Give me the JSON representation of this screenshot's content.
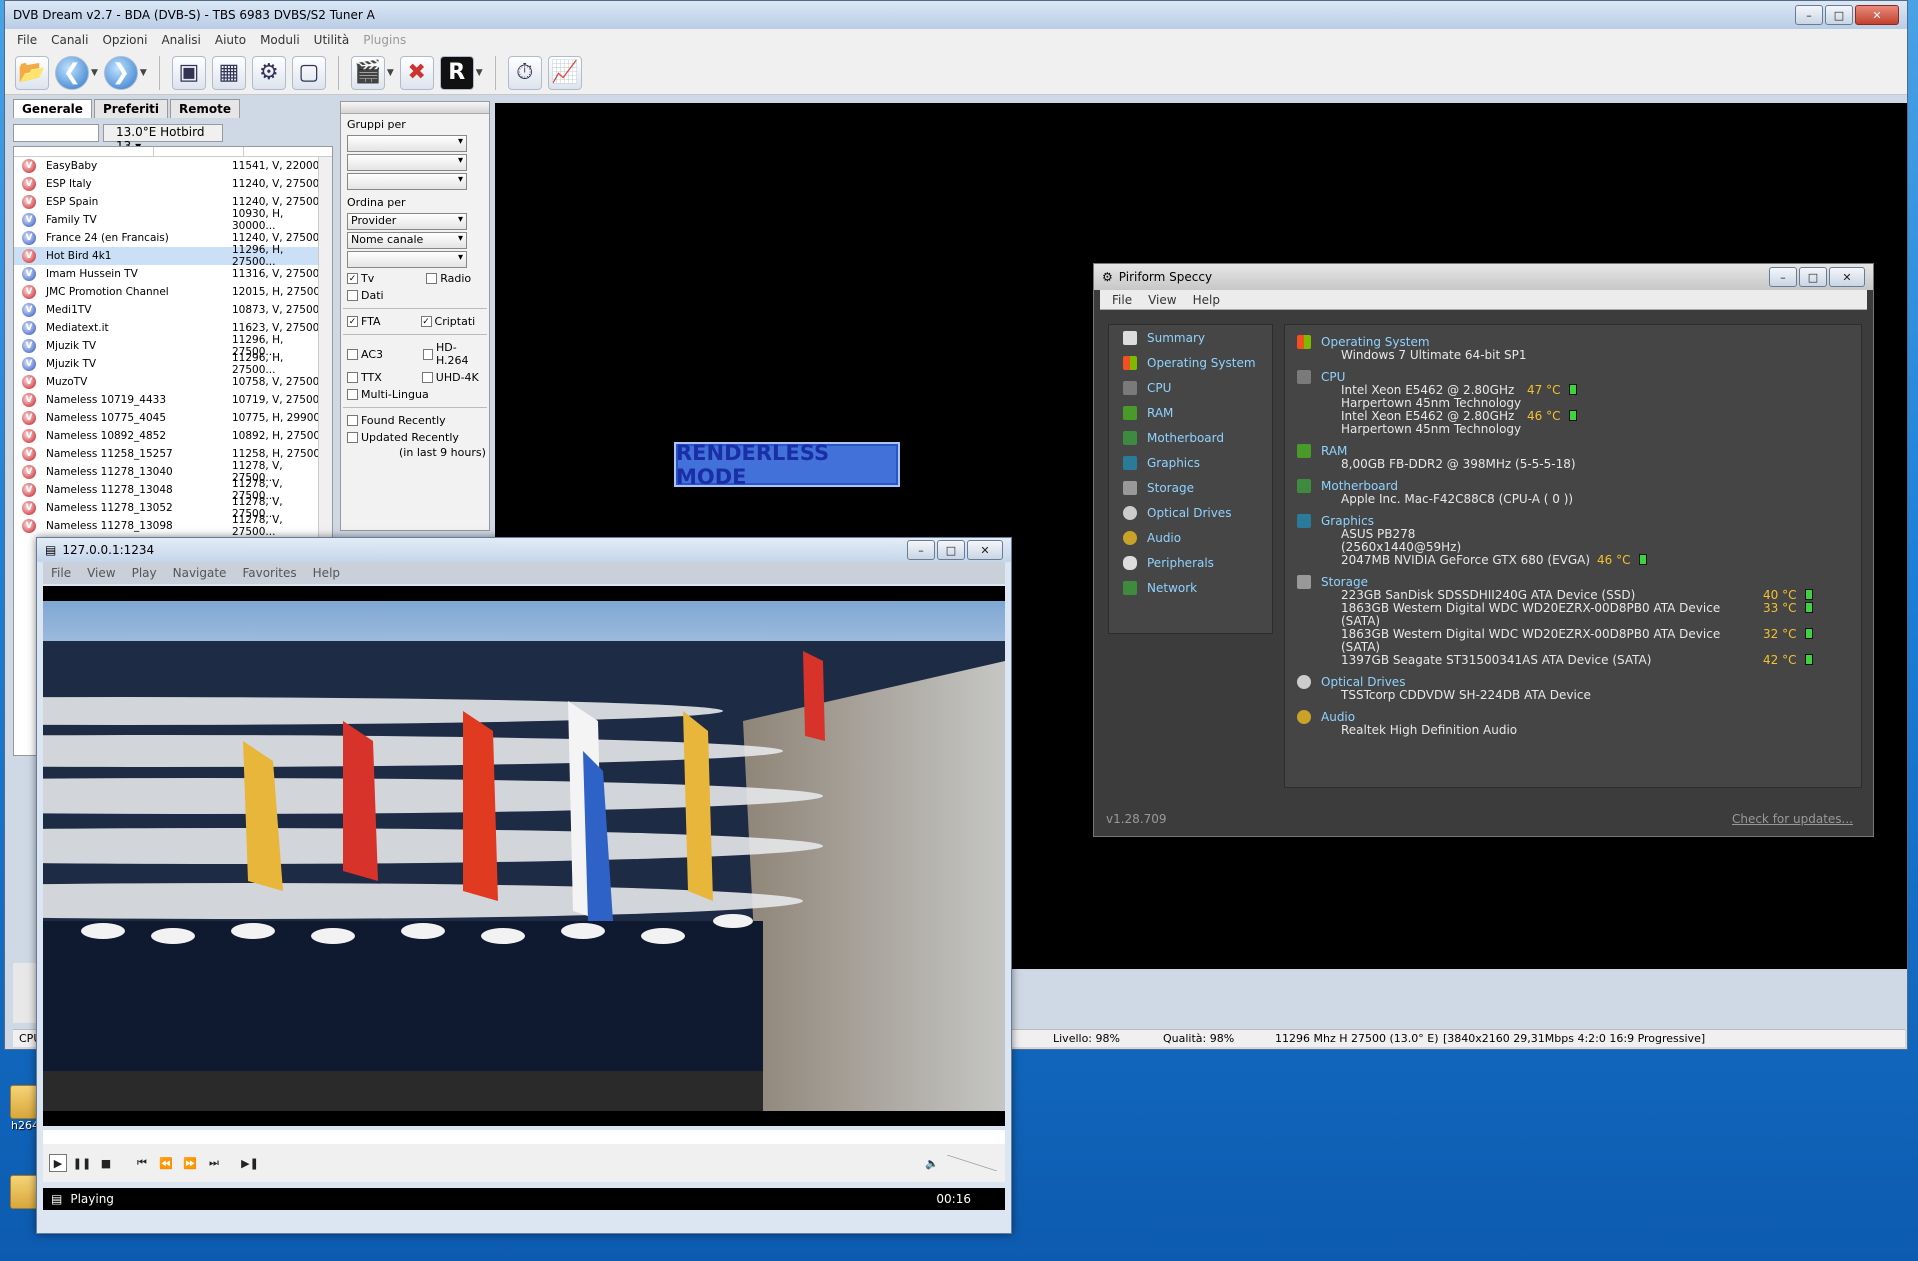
{
  "desktop": {
    "icons": [
      {
        "label": "h264ts"
      },
      {
        "label": ""
      }
    ]
  },
  "dvb": {
    "title": "DVB Dream v2.7 - BDA (DVB-S) - TBS 6983 DVBS/S2 Tuner A",
    "menu": [
      "File",
      "Canali",
      "Opzioni",
      "Analisi",
      "Aiuto",
      "Moduli",
      "Utilità",
      "Plugins"
    ],
    "tabs": [
      "Generale",
      "Preferiti",
      "Remote"
    ],
    "satellite": "13.0°E Hotbird 13",
    "channels": [
      {
        "name": "EasyBaby",
        "freq": "11541, V, 22000",
        "icon": "red"
      },
      {
        "name": "ESP Italy",
        "freq": "11240, V, 27500",
        "icon": "red"
      },
      {
        "name": "ESP Spain",
        "freq": "11240, V, 27500",
        "icon": "red"
      },
      {
        "name": "Family TV",
        "freq": "10930, H, 30000...",
        "icon": "blue"
      },
      {
        "name": "France 24 (en Francais)",
        "freq": "11240, V, 27500",
        "icon": "blue"
      },
      {
        "name": "Hot Bird 4k1",
        "freq": "11296, H, 27500...",
        "icon": "red"
      },
      {
        "name": "Imam Hussein TV",
        "freq": "11316, V, 27500",
        "icon": "blue"
      },
      {
        "name": "JMC Promotion Channel",
        "freq": "12015, H, 27500",
        "icon": "red"
      },
      {
        "name": "Medi1TV",
        "freq": "10873, V, 27500",
        "icon": "blue"
      },
      {
        "name": "Mediatext.it",
        "freq": "11623, V, 27500",
        "icon": "blue"
      },
      {
        "name": "Mjuzik TV",
        "freq": "11296, H, 27500...",
        "icon": "blue"
      },
      {
        "name": "Mjuzik TV",
        "freq": "11296, H, 27500...",
        "icon": "blue"
      },
      {
        "name": "MuzoTV",
        "freq": "10758, V, 27500",
        "icon": "red"
      },
      {
        "name": "Nameless 10719_4433",
        "freq": "10719, V, 27500",
        "icon": "red"
      },
      {
        "name": "Nameless 10775_4045",
        "freq": "10775, H, 29900",
        "icon": "red"
      },
      {
        "name": "Nameless 10892_4852",
        "freq": "10892, H, 27500",
        "icon": "red"
      },
      {
        "name": "Nameless 11258_15257",
        "freq": "11258, H, 27500",
        "icon": "red"
      },
      {
        "name": "Nameless 11278_13040",
        "freq": "11278, V, 27500...",
        "icon": "red"
      },
      {
        "name": "Nameless 11278_13048",
        "freq": "11278, V, 27500...",
        "icon": "red"
      },
      {
        "name": "Nameless 11278_13052",
        "freq": "11278, V, 27500...",
        "icon": "red"
      },
      {
        "name": "Nameless 11278_13098",
        "freq": "11278, V, 27500...",
        "icon": "red"
      }
    ],
    "filters": {
      "group_label": "Gruppi per",
      "order_label": "Ordina per",
      "order1": "Provider",
      "order2": "Nome canale",
      "tv": "Tv",
      "radio": "Radio",
      "dati": "Dati",
      "fta": "FTA",
      "criptati": "Criptati",
      "ac3": "AC3",
      "hd": "HD-H.264",
      "ttx": "TTX",
      "uhd": "UHD-4K",
      "multi": "Multi-Lingua",
      "found": "Found Recently",
      "updated": "Updated Recently",
      "updated_sub": "(in last 9 hours)"
    },
    "renderless": "RENDERLESS MODE",
    "status": {
      "cpu": "CPU",
      "livello": "Livello: 98%",
      "qualita": "Qualità: 98%",
      "freq": "11296 Mhz  H  27500  (13.0° E)",
      "video": "[3840x2160  29,31Mbps 4:2:0  16:9 Progressive]"
    }
  },
  "speccy": {
    "title": "Piriform Speccy",
    "menu": [
      "File",
      "View",
      "Help"
    ],
    "nav": [
      "Summary",
      "Operating System",
      "CPU",
      "RAM",
      "Motherboard",
      "Graphics",
      "Storage",
      "Optical Drives",
      "Audio",
      "Peripherals",
      "Network"
    ],
    "os": {
      "title": "Operating System",
      "value": "Windows 7 Ultimate 64-bit SP1"
    },
    "cpu": {
      "title": "CPU",
      "lines": [
        {
          "text": "Intel Xeon E5462 @ 2.80GHz",
          "temp": "47 °C"
        },
        {
          "text": "Harpertown 45nm Technology",
          "temp": ""
        },
        {
          "text": "Intel Xeon E5462 @ 2.80GHz",
          "temp": "46 °C"
        },
        {
          "text": "Harpertown 45nm Technology",
          "temp": ""
        }
      ]
    },
    "ram": {
      "title": "RAM",
      "value": "8,00GB FB-DDR2 @ 398MHz (5-5-5-18)"
    },
    "motherboard": {
      "title": "Motherboard",
      "value": "Apple Inc. Mac-F42C88C8 (CPU-A ( 0 ))"
    },
    "graphics": {
      "title": "Graphics",
      "lines": [
        {
          "text": "ASUS PB278 (2560x1440@59Hz)",
          "temp": ""
        },
        {
          "text": "2047MB NVIDIA GeForce GTX 680 (EVGA)",
          "temp": "46 °C"
        }
      ]
    },
    "storage": {
      "title": "Storage",
      "lines": [
        {
          "text": "223GB SanDisk SDSSDHII240G ATA Device (SSD)",
          "temp": "40 °C"
        },
        {
          "text": "1863GB Western Digital WDC WD20EZRX-00D8PB0 ATA Device (SATA)",
          "temp": "33 °C"
        },
        {
          "text": "1863GB Western Digital WDC WD20EZRX-00D8PB0 ATA Device (SATA)",
          "temp": "32 °C"
        },
        {
          "text": "1397GB Seagate ST31500341AS ATA Device (SATA)",
          "temp": "42 °C"
        }
      ]
    },
    "optical": {
      "title": "Optical Drives",
      "value": "TSSTcorp CDDVDW SH-224DB ATA Device"
    },
    "audio": {
      "title": "Audio",
      "value": "Realtek High Definition Audio"
    },
    "version": "v1.28.709",
    "update": "Check for updates..."
  },
  "player": {
    "title": "127.0.0.1:1234",
    "menu": [
      "File",
      "View",
      "Play",
      "Navigate",
      "Favorites",
      "Help"
    ],
    "status": "Playing",
    "time": "00:16"
  },
  "colors": {
    "accent": "#8fd3ff",
    "temp": "#f2c230",
    "renderless_bg": "#4272d9"
  }
}
